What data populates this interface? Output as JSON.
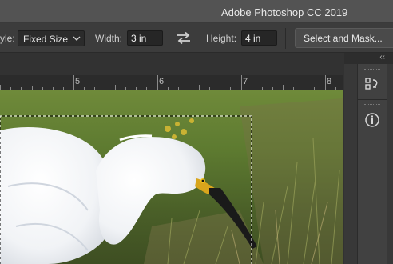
{
  "app": {
    "title": "Adobe Photoshop CC 2019"
  },
  "options": {
    "style_label": "yle:",
    "style_value": "Fixed Size",
    "width_label": "Width:",
    "width_value": "3 in",
    "height_label": "Height:",
    "height_value": "4 in",
    "select_mask_label": "Select and Mask..."
  },
  "ruler": {
    "marks": [
      "5",
      "6",
      "7",
      "8"
    ]
  },
  "panel": {
    "collapse_glyph": "‹‹"
  },
  "icons": [
    "chevron-down-icon",
    "swap-arrows-icon",
    "history-icon",
    "info-icon"
  ]
}
